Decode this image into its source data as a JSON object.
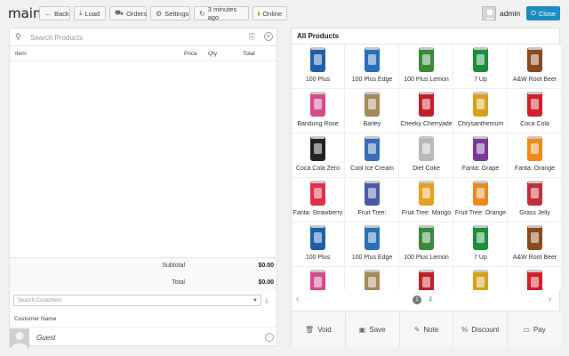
{
  "app": {
    "title": "main"
  },
  "toolbar": {
    "back_label": "Back",
    "load_label": "Load",
    "orders_label": "Orders",
    "settings_label": "Settings",
    "sync_label": "3 minutes ago",
    "status_label": "Online",
    "status_color": "#7ac143"
  },
  "user": {
    "name": "admin",
    "close_label": "Close",
    "close_color": "#1e8cbe"
  },
  "cart": {
    "search_placeholder": "Search Products",
    "columns": {
      "item": "Item",
      "price": "Price",
      "qty": "Qty",
      "total": "Total"
    },
    "subtotal_label": "Subtotal",
    "subtotal_value": "$0.00",
    "total_label": "Total",
    "total_value": "$0.00"
  },
  "customer": {
    "search_placeholder": "Search Customers",
    "column_header": "Customer Name",
    "current": "Guest"
  },
  "products": {
    "heading": "All Products",
    "items": [
      {
        "name": "100 Plus",
        "color": "#1f5fa8"
      },
      {
        "name": "100 Plus Edge",
        "color": "#2a6fb8"
      },
      {
        "name": "100 Plus Lemon",
        "color": "#3a8a3a"
      },
      {
        "name": "7 Up",
        "color": "#1b8f3a"
      },
      {
        "name": "A&W Root Beer",
        "color": "#8a4a20"
      },
      {
        "name": "Bandung Rose",
        "color": "#d64a8c"
      },
      {
        "name": "Barley",
        "color": "#a58a5a"
      },
      {
        "name": "Cheeky Cherryade",
        "color": "#c0202a"
      },
      {
        "name": "Chrysanthemum",
        "color": "#d6a21c"
      },
      {
        "name": "Coca Cola",
        "color": "#d0202a"
      },
      {
        "name": "Coca Cola Zero",
        "color": "#222222"
      },
      {
        "name": "Cool Ice Cream",
        "color": "#3a6ab8"
      },
      {
        "name": "Diet Coke",
        "color": "#b8b8b8"
      },
      {
        "name": "Fanta: Grape",
        "color": "#7a3a9a"
      },
      {
        "name": "Fanta: Orange",
        "color": "#f08a1a"
      },
      {
        "name": "Fanta: Strawberry",
        "color": "#e0304a"
      },
      {
        "name": "Fruit Tree:",
        "color": "#4a5aa8"
      },
      {
        "name": "Fruit Tree: Mango",
        "color": "#e6a020"
      },
      {
        "name": "Fruit Tree: Orange",
        "color": "#e88a20"
      },
      {
        "name": "Grass Jelly",
        "color": "#c0303a"
      },
      {
        "name": "100 Plus",
        "color": "#1f5fa8"
      },
      {
        "name": "100 Plus Edge",
        "color": "#2a6fb8"
      },
      {
        "name": "100 Plus Lemon",
        "color": "#3a8a3a"
      },
      {
        "name": "7 Up",
        "color": "#1b8f3a"
      },
      {
        "name": "A&W Root Beer",
        "color": "#8a4a20"
      },
      {
        "name": "",
        "color": "#d64a8c"
      },
      {
        "name": "",
        "color": "#a58a5a"
      },
      {
        "name": "",
        "color": "#c0202a"
      },
      {
        "name": "",
        "color": "#d6a21c"
      },
      {
        "name": "",
        "color": "#d0202a"
      }
    ]
  },
  "pagination": {
    "pages": [
      "1",
      "2"
    ],
    "current": "1"
  },
  "actions": {
    "void_label": "Void",
    "save_label": "Save",
    "note_label": "Note",
    "discount_label": "Discount",
    "pay_label": "Pay"
  }
}
